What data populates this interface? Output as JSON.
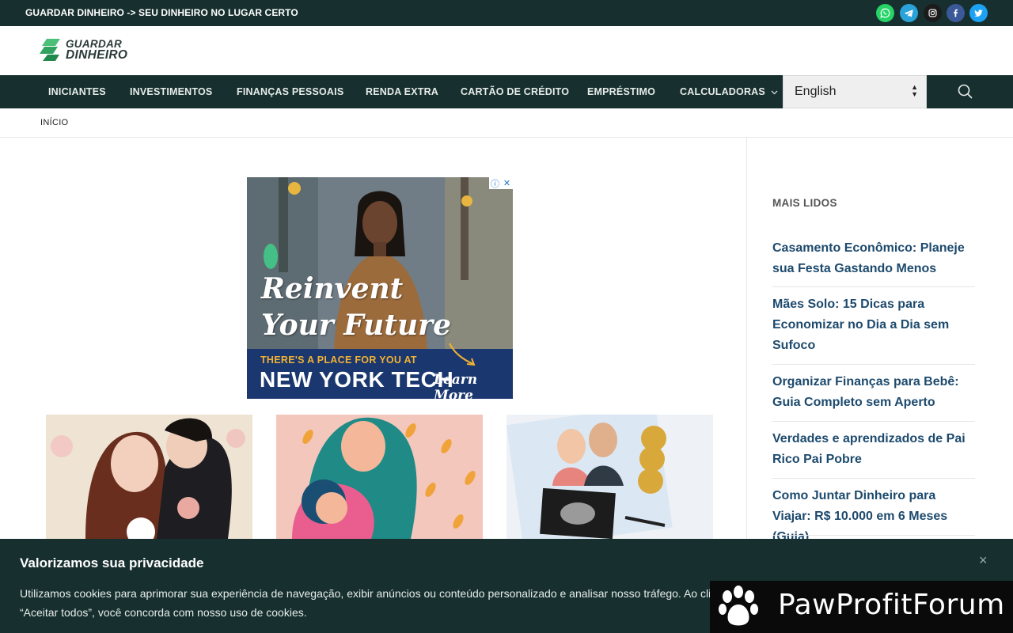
{
  "topbar": {
    "tagline": "GUARDAR DINHEIRO -> SEU DINHEIRO NO LUGAR CERTO",
    "social": [
      {
        "icon": "whatsapp-icon",
        "color": "#25d366"
      },
      {
        "icon": "telegram-icon",
        "color": "#2aa3db"
      },
      {
        "icon": "instagram-icon",
        "color": "#1b1b1b"
      },
      {
        "icon": "facebook-icon",
        "color": "#3b5998"
      },
      {
        "icon": "twitter-icon",
        "color": "#1da1f2"
      }
    ]
  },
  "logo": {
    "line1": "GUARDAR",
    "line2": "DINHEIRO",
    "accent": "#3cb371"
  },
  "nav": {
    "items": [
      "INICIANTES",
      "INVESTIMENTOS",
      "FINANÇAS PESSOAIS",
      "RENDA EXTRA",
      "CARTÃO DE CRÉDITO",
      "EMPRÉSTIMO",
      "CALCULADORAS"
    ],
    "language": "English"
  },
  "breadcrumb": {
    "label": "INÍCIO"
  },
  "ad": {
    "headline_1": "Reinvent",
    "headline_2": "Your Future",
    "tagline": "THERE'S A PLACE FOR YOU AT",
    "brand": "NEW YORK TECH",
    "cta": "Learn More"
  },
  "sidebar": {
    "title": "MAIS LIDOS",
    "items": [
      "Casamento Econômico: Planeje sua Festa Gastando Menos",
      "Mães Solo: 15 Dicas para Economizar no Dia a Dia sem Sufoco",
      "Organizar Finanças para Bebê: Guia Completo sem Aperto",
      "Verdades e aprendizados de Pai Rico Pai Pobre",
      "Como Juntar Dinheiro para Viajar: R$ 10.000 em 6 Meses (Guia)"
    ]
  },
  "cookie": {
    "title": "Valorizamos sua privacidade",
    "text": "Utilizamos cookies para aprimorar sua experiência de navegação, exibir anúncios ou conteúdo personalizado e analisar nosso tráfego. Ao cli",
    "text_2": "“Aceitar todos”, você concorda com nosso uso de cookies.",
    "close": "×"
  },
  "watermark": {
    "text": "PawProfitForum"
  }
}
